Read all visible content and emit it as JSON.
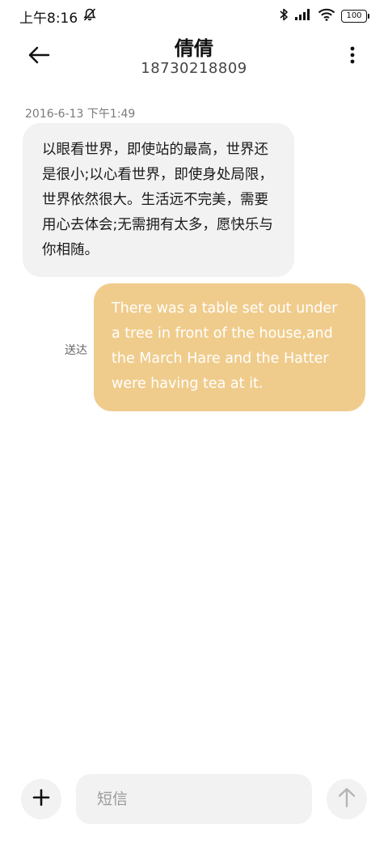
{
  "status_bar": {
    "time": "上午8:16",
    "battery": "100",
    "icons": [
      "mute-icon",
      "bluetooth-icon",
      "signal-icon",
      "wifi-icon",
      "battery-icon"
    ]
  },
  "header": {
    "contact_name": "倩倩",
    "contact_number": "18730218809",
    "icons": [
      "back-arrow-icon",
      "more-vertical-icon"
    ]
  },
  "conversation": {
    "timestamp": "2016-6-13 下午1:49",
    "messages": [
      {
        "direction": "incoming",
        "text": "以眼看世界，即使站的最高，世界还是很小;以心看世界，即使身处局限，世界依然很大。生活远不完美，需要用心去体会;无需拥有太多，愿快乐与你相随。"
      },
      {
        "direction": "outgoing",
        "text": "There was a table set out under a tree in front of the house,and the March Hare and the Hatter were having tea at it.",
        "status": "送达"
      }
    ]
  },
  "composer": {
    "placeholder": "短信",
    "value": "",
    "icons": [
      "plus-icon",
      "send-arrow-icon"
    ]
  },
  "colors": {
    "incoming_bubble": "#f2f2f2",
    "outgoing_bubble": "#f0cc8c",
    "outgoing_text": "#ffffff"
  }
}
